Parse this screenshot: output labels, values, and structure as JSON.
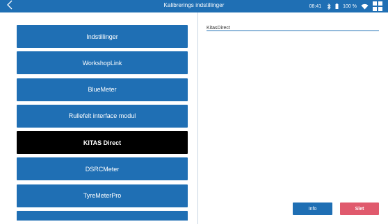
{
  "header": {
    "title": "Kalibrerings indstillinger",
    "time": "08:41",
    "battery": "100 %",
    "icons": [
      "back-chevron-icon",
      "bluetooth-icon",
      "battery-icon",
      "wifi-icon",
      "app-grid-icon"
    ],
    "bar_color": "#1f6fb4"
  },
  "menu": {
    "items": [
      {
        "label": "Indstillinger"
      },
      {
        "label": "WorkshopLink"
      },
      {
        "label": "BlueMeter"
      },
      {
        "label": "Rullefelt interface modul"
      },
      {
        "label": "KITAS Direct"
      },
      {
        "label": "DSRCMeter"
      },
      {
        "label": "TyreMeterPro"
      },
      {
        "label": ""
      }
    ],
    "active_index": 4,
    "button_color": "#1f6fb4",
    "active_color": "#000000"
  },
  "detail": {
    "title": "KitasDirect"
  },
  "actions": {
    "info_label": "Info",
    "delete_label": "Slet",
    "info_color": "#1f6fb4",
    "delete_color": "#e05a6d"
  }
}
